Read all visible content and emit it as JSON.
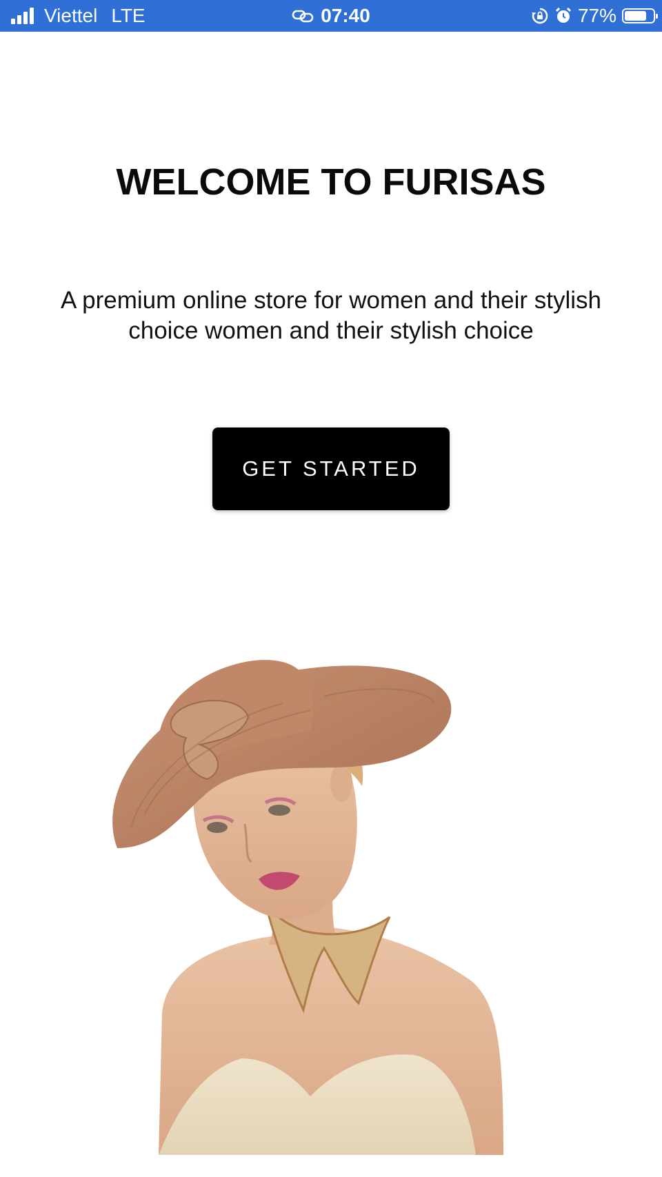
{
  "status_bar": {
    "carrier": "Viettel",
    "network": "LTE",
    "time": "07:40",
    "battery_percent": "77%",
    "battery_level": 0.77,
    "background_color": "#2f6fd6",
    "icons": [
      "signal-icon",
      "link-icon",
      "rotation-lock-icon",
      "alarm-icon",
      "battery-icon"
    ]
  },
  "welcome": {
    "title": "WELCOME TO FURISAS",
    "subtitle": "A premium online store for women and their stylish choice women and their stylish choice",
    "cta_label": "GET STARTED"
  },
  "hero_image": {
    "description_icon": "woman-in-hat-image"
  }
}
